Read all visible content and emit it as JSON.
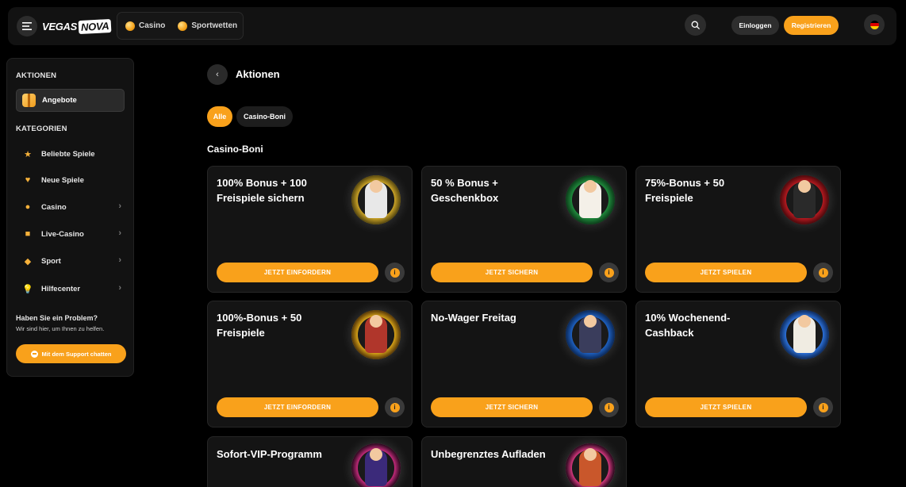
{
  "header": {
    "logo_part1": "VEGAS",
    "logo_part2": "NOVA",
    "nav": [
      {
        "label": "Casino",
        "icon": "coin-icon"
      },
      {
        "label": "Sportwetten",
        "icon": "coin-icon"
      }
    ],
    "login_label": "Einloggen",
    "register_label": "Registrieren",
    "accent_color": "#f9a11b"
  },
  "sidebar": {
    "section_actions": "AKTIONEN",
    "active_item": "Angebote",
    "section_categories": "KATEGORIEN",
    "items": [
      {
        "label": "Beliebte Spiele",
        "icon": "star-icon",
        "chevron": false
      },
      {
        "label": "Neue Spiele",
        "icon": "heart-icon",
        "chevron": false
      },
      {
        "label": "Casino",
        "icon": "coin-icon",
        "chevron": true
      },
      {
        "label": "Live-Casino",
        "icon": "chip-icon",
        "chevron": true
      },
      {
        "label": "Sport",
        "icon": "ball-icon",
        "chevron": true
      },
      {
        "label": "Hilfecenter",
        "icon": "bulb-icon",
        "chevron": true
      }
    ],
    "help_title": "Haben Sie ein Problem?",
    "help_sub": "Wir sind hier, um Ihnen zu helfen.",
    "support_label": "Mit dem Support chatten"
  },
  "main": {
    "page_title": "Aktionen",
    "filters": [
      "Alle",
      "Casino-Boni"
    ],
    "section_title": "Casino-Boni",
    "cards": [
      {
        "title": "100% Bonus + 100 Freispiele sichern",
        "button": "JETZT EINFORDERN",
        "art_ring": "#c9a227",
        "art_body": "#e8e8e8"
      },
      {
        "title": "50 % Bonus + Geschenkbox",
        "button": "JETZT SICHERN",
        "art_ring": "#1f8a3c",
        "art_body": "#f4f0e8"
      },
      {
        "title": "75%-Bonus + 50 Freispiele",
        "button": "JETZT SPIELEN",
        "art_ring": "#b3191f",
        "art_body": "#2a2a2a"
      },
      {
        "title": "100%-Bonus + 50 Freispiele",
        "button": "JETZT EINFORDERN",
        "art_ring": "#d4a017",
        "art_body": "#b0362b"
      },
      {
        "title": "No-Wager Freitag",
        "button": "JETZT SICHERN",
        "art_ring": "#1d5fbf",
        "art_body": "#3a3d5c"
      },
      {
        "title": "10% Wochenend-Cashback",
        "button": "JETZT SPIELEN",
        "art_ring": "#2b6fd6",
        "art_body": "#f0ece2"
      },
      {
        "title": "Sofort-VIP-Programm",
        "button": "",
        "art_ring": "#c22a7a",
        "art_body": "#3b2a7a"
      },
      {
        "title": "Unbegrenztes Aufladen",
        "button": "",
        "art_ring": "#d2367c",
        "art_body": "#c9572b"
      }
    ]
  }
}
